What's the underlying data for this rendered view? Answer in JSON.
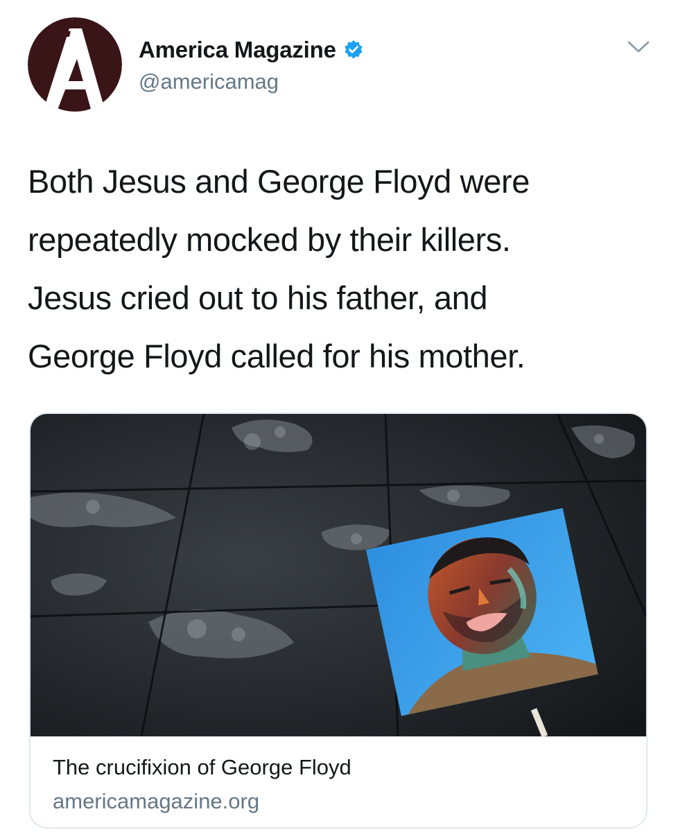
{
  "account": {
    "display_name": "America Magazine",
    "handle": "@americamag",
    "avatar_letter": "A",
    "verified": true
  },
  "tweet": {
    "text": "Both Jesus and George Floyd were\nrepeatedly mocked by their killers.\nJesus cried out to his father, and\nGeorge Floyd called for his mother."
  },
  "link_card": {
    "title": "The crucifixion of George Floyd",
    "domain": "americamagazine.org",
    "image_icon": "photo-of-painted-portrait-sign-on-pavement"
  },
  "icons": {
    "verified": "verified-badge-icon",
    "menu": "chevron-down-icon"
  },
  "colors": {
    "verified_blue": "#1da1f2",
    "secondary_text": "#657786",
    "avatar_bg": "#3a1518"
  }
}
